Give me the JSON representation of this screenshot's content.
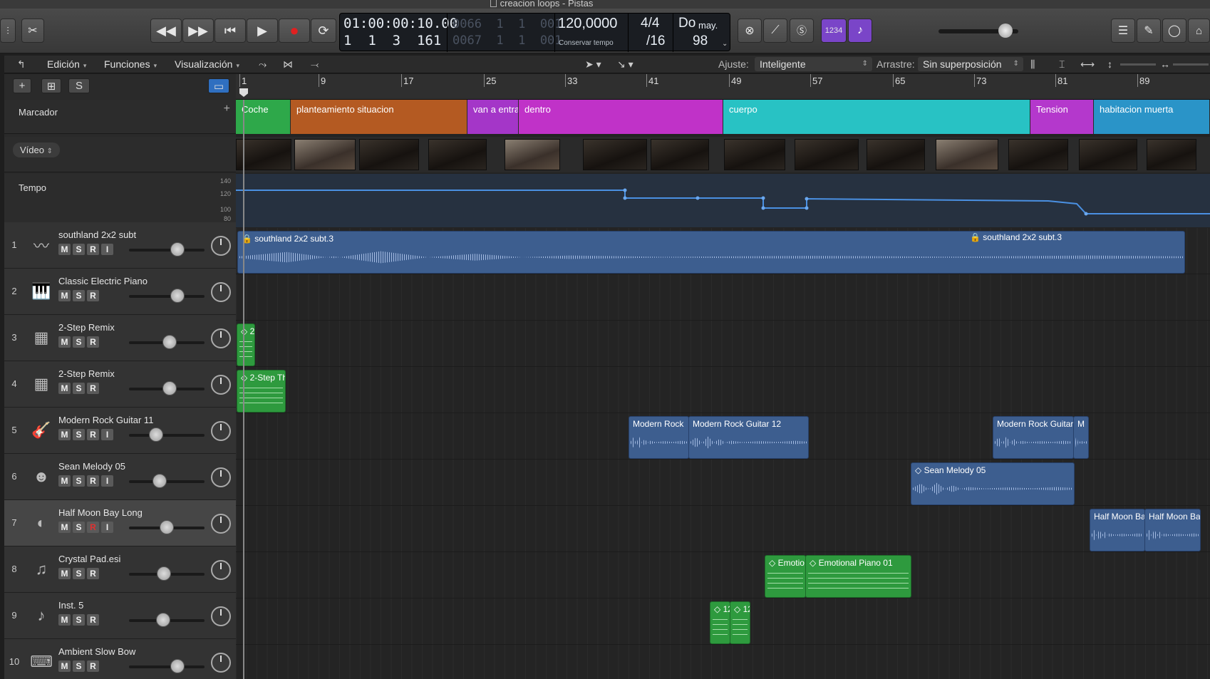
{
  "window": {
    "title": "creacion loops - Pistas"
  },
  "transport": {
    "rewind": "◀◀",
    "forward": "▶▶",
    "to_start": "⏮",
    "play": "▶",
    "record": "●",
    "cycle": "⟳",
    "smpte": "01:00:00:10.00",
    "position": "1  1  3  161",
    "end_top_dim": "0066  1  1  001",
    "end_bottom_dim": "0067  1  1  001",
    "tempo": "120,0000",
    "tempo_mode": "Conservar tempo",
    "signature_top": "4/4",
    "signature_bottom": "/16",
    "key": "Do",
    "key_mode": "may.",
    "key_num": "98",
    "count_in": "1234"
  },
  "toolbar": {
    "menus": [
      "Edición",
      "Funciones",
      "Visualización"
    ],
    "snap_label": "Ajuste:",
    "snap_value": "Inteligente",
    "drag_label": "Arrastre:",
    "drag_value": "Sin superposición"
  },
  "header_buttons": {
    "add": "+",
    "s": "S"
  },
  "global_tracks": {
    "marker_label": "Marcador",
    "video_label": "Vídeo",
    "tempo_label": "Tempo",
    "tempo_ticks": [
      "140",
      "120",
      "100",
      "80"
    ]
  },
  "ruler": {
    "bars": [
      "1",
      "9",
      "17",
      "25",
      "33",
      "41",
      "49",
      "57",
      "65",
      "73",
      "81",
      "89"
    ]
  },
  "markers": [
    {
      "name": "Coche",
      "color": "#2ea84a"
    },
    {
      "name": "planteamiento situacion",
      "color": "#b45a22"
    },
    {
      "name": "van a entrar",
      "color": "#a436c8"
    },
    {
      "name": "dentro",
      "color": "#c032c8"
    },
    {
      "name": "cuerpo",
      "color": "#28c2c4"
    },
    {
      "name": "Tension",
      "color": "#b438cc"
    },
    {
      "name": "habitacion muerta",
      "color": "#2a94c8"
    }
  ],
  "tracks": [
    {
      "num": "1",
      "name": "southland 2x2 subt",
      "icon": "waveform-icon",
      "buttons": [
        "M",
        "S",
        "R",
        "I"
      ],
      "volume": 0.68
    },
    {
      "num": "2",
      "name": "Classic Electric Piano",
      "icon": "piano-icon",
      "buttons": [
        "M",
        "S",
        "R"
      ],
      "volume": 0.68
    },
    {
      "num": "3",
      "name": "2-Step Remix",
      "icon": "drum-machine-icon",
      "buttons": [
        "M",
        "S",
        "R"
      ],
      "volume": 0.55
    },
    {
      "num": "4",
      "name": "2-Step Remix",
      "icon": "drum-machine-icon",
      "buttons": [
        "M",
        "S",
        "R"
      ],
      "volume": 0.55
    },
    {
      "num": "5",
      "name": "Modern Rock Guitar 11",
      "icon": "electric-guitar-icon",
      "buttons": [
        "M",
        "S",
        "R",
        "I"
      ],
      "volume": 0.33
    },
    {
      "num": "6",
      "name": "Sean Melody 05",
      "icon": "choir-icon",
      "buttons": [
        "M",
        "S",
        "R",
        "I"
      ],
      "volume": 0.38
    },
    {
      "num": "7",
      "name": "Half Moon Bay Long",
      "icon": "speaker-icon",
      "buttons": [
        "M",
        "S",
        "R",
        "I"
      ],
      "volume": 0.5
    },
    {
      "num": "8",
      "name": "Crystal Pad.esi",
      "icon": "grand-piano-icon",
      "buttons": [
        "M",
        "S",
        "R"
      ],
      "volume": 0.45
    },
    {
      "num": "9",
      "name": "Inst. 5",
      "icon": "acoustic-guitar-icon",
      "buttons": [
        "M",
        "S",
        "R"
      ],
      "volume": 0.44
    },
    {
      "num": "10",
      "name": "Ambient Slow Bow",
      "icon": "keyboard-stand-icon",
      "buttons": [
        "M",
        "S",
        "R"
      ],
      "volume": 0.68
    }
  ],
  "regions": {
    "t1a": "southland 2x2 subt.3",
    "t1b": "southland 2x2 subt.3",
    "t3": "2-",
    "t4": "2-Step Th",
    "t5a": "Modern Rock",
    "t5b": "Modern Rock Guitar 12",
    "t5c": "Modern Rock Guitar",
    "t5d": "M",
    "t6": "Sean Melody 05",
    "t7a": "Half Moon Ba",
    "t7b": "Half Moon Ba",
    "t8a": "Emotio",
    "t8b": "Emotional Piano 01",
    "t9a": "12",
    "t9b": "12"
  },
  "colors": {
    "audio_region": "#3d5e8f",
    "midi_region": "#2e9a3e",
    "tempo_line": "#4a90e2"
  }
}
